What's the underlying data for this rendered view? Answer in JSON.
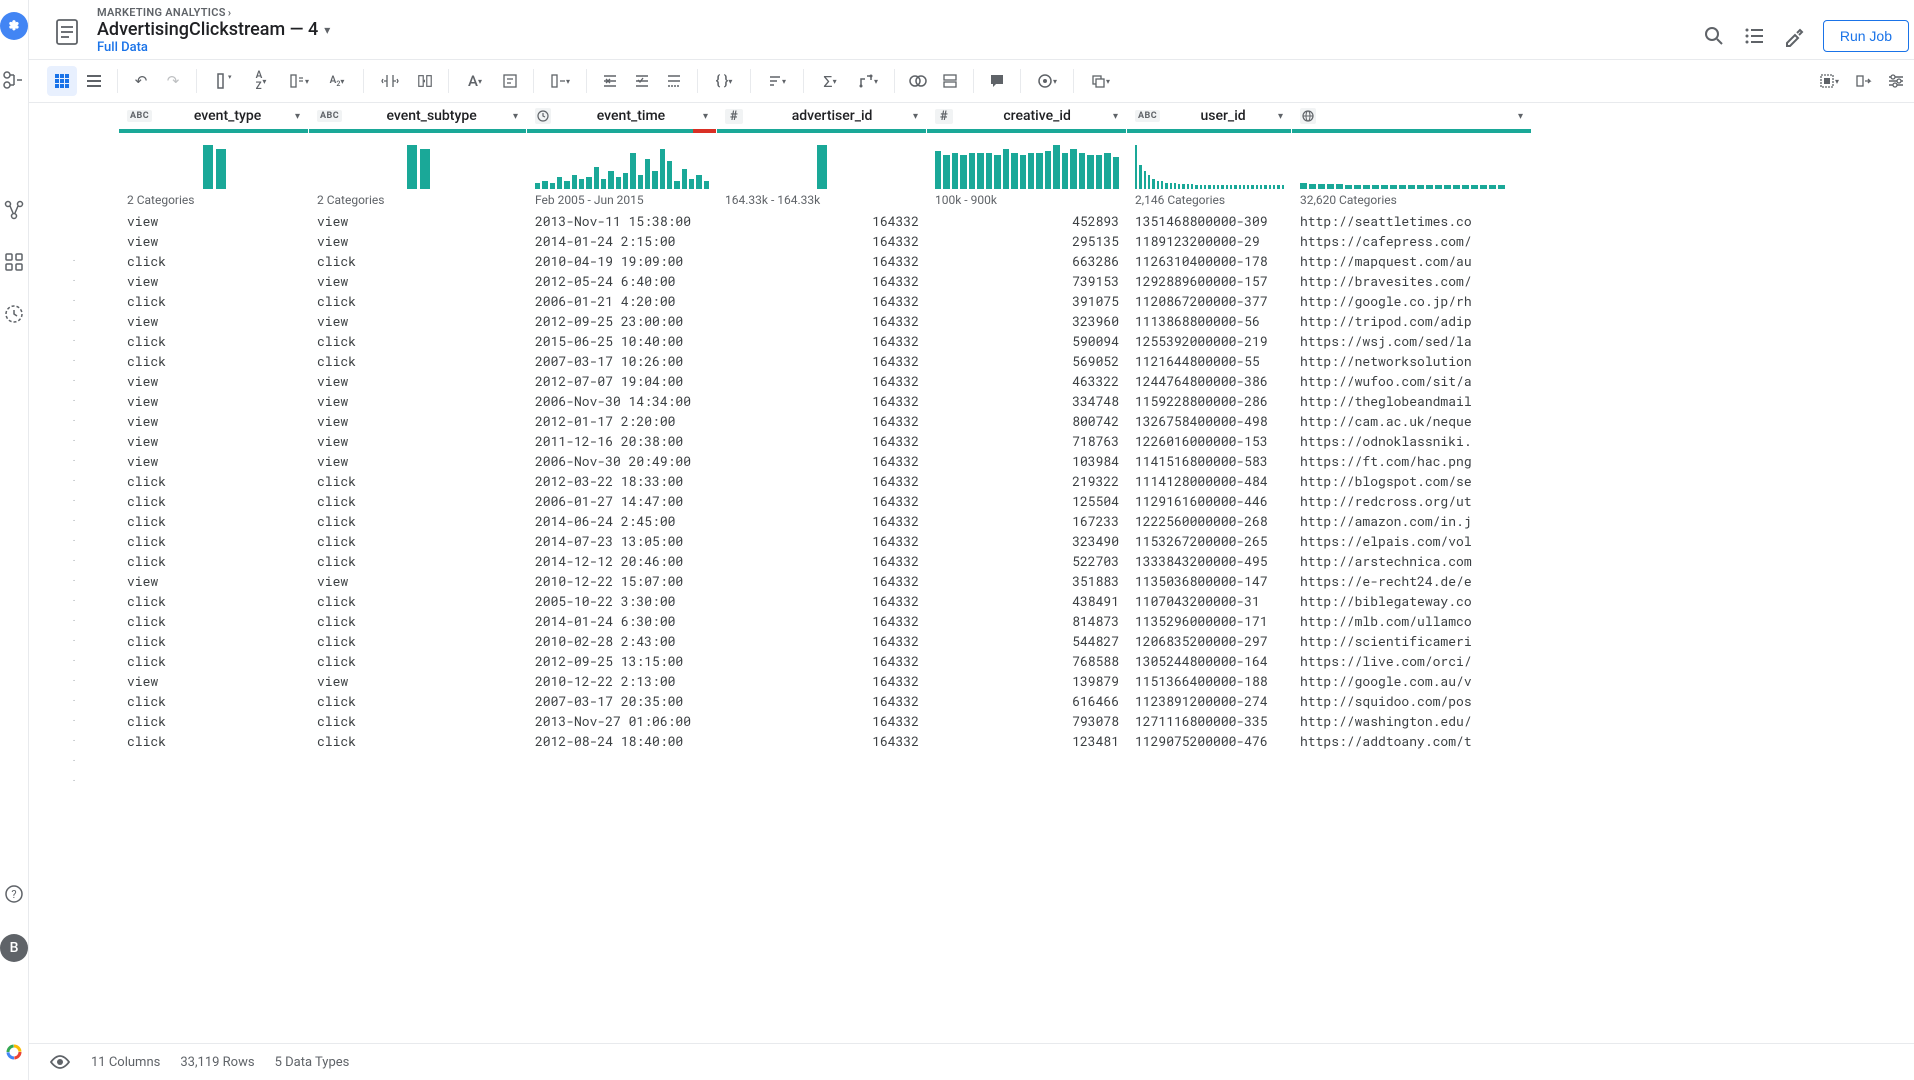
{
  "breadcrumb": {
    "project": "MARKETING ANALYTICS"
  },
  "title": "AdvertisingClickstream — 4",
  "subtitle": "Full Data",
  "run_button_label": "Run Job",
  "avatar_letter": "B",
  "footer": {
    "columns": "11 Columns",
    "rows": "33,119 Rows",
    "types": "5 Data Types"
  },
  "columns": [
    {
      "key": "event_type",
      "label": "event_type",
      "type": "ABC",
      "summary": "2 Categories"
    },
    {
      "key": "event_subtype",
      "label": "event_subtype",
      "type": "ABC",
      "summary": "2 Categories"
    },
    {
      "key": "event_time",
      "label": "event_time",
      "type": "clock",
      "summary": "Feb 2005 - Jun 2015",
      "has_error": true
    },
    {
      "key": "advertiser_id",
      "label": "advertiser_id",
      "type": "#",
      "summary": "164.33k - 164.33k"
    },
    {
      "key": "creative_id",
      "label": "creative_id",
      "type": "#",
      "summary": "100k - 900k"
    },
    {
      "key": "user_id",
      "label": "user_id",
      "type": "ABC",
      "summary": "2,146 Categories"
    },
    {
      "key": "url",
      "label": "",
      "type": "globe",
      "summary": "32,620 Categories"
    }
  ],
  "rows": [
    {
      "event_type": "view",
      "event_subtype": "view",
      "event_time": "2013-Nov-11 15:38:00",
      "advertiser_id": "164332",
      "creative_id": "452893",
      "user_id": "1351468800000-309",
      "url": "http://seattletimes.co"
    },
    {
      "event_type": "view",
      "event_subtype": "view",
      "event_time": "2014-01-24 2:15:00",
      "advertiser_id": "164332",
      "creative_id": "295135",
      "user_id": "1189123200000-29",
      "url": "https://cafepress.com/"
    },
    {
      "event_type": "click",
      "event_subtype": "click",
      "event_time": "2010-04-19 19:09:00",
      "advertiser_id": "164332",
      "creative_id": "663286",
      "user_id": "1126310400000-178",
      "url": "http://mapquest.com/au"
    },
    {
      "event_type": "view",
      "event_subtype": "view",
      "event_time": "2012-05-24 6:40:00",
      "advertiser_id": "164332",
      "creative_id": "739153",
      "user_id": "1292889600000-157",
      "url": "http://bravesites.com/"
    },
    {
      "event_type": "click",
      "event_subtype": "click",
      "event_time": "2006-01-21 4:20:00",
      "advertiser_id": "164332",
      "creative_id": "391075",
      "user_id": "1120867200000-377",
      "url": "http://google.co.jp/rh"
    },
    {
      "event_type": "view",
      "event_subtype": "view",
      "event_time": "2012-09-25 23:00:00",
      "advertiser_id": "164332",
      "creative_id": "323960",
      "user_id": "1113868800000-56",
      "url": "http://tripod.com/adip"
    },
    {
      "event_type": "click",
      "event_subtype": "click",
      "event_time": "2015-06-25 10:40:00",
      "advertiser_id": "164332",
      "creative_id": "590094",
      "user_id": "1255392000000-219",
      "url": "https://wsj.com/sed/la"
    },
    {
      "event_type": "click",
      "event_subtype": "click",
      "event_time": "2007-03-17 10:26:00",
      "advertiser_id": "164332",
      "creative_id": "569052",
      "user_id": "1121644800000-55",
      "url": "http://networksolution"
    },
    {
      "event_type": "view",
      "event_subtype": "view",
      "event_time": "2012-07-07 19:04:00",
      "advertiser_id": "164332",
      "creative_id": "463322",
      "user_id": "1244764800000-386",
      "url": "http://wufoo.com/sit/a"
    },
    {
      "event_type": "view",
      "event_subtype": "view",
      "event_time": "2006-Nov-30 14:34:00",
      "advertiser_id": "164332",
      "creative_id": "334748",
      "user_id": "1159228800000-286",
      "url": "http://theglobeandmail"
    },
    {
      "event_type": "view",
      "event_subtype": "view",
      "event_time": "2012-01-17 2:20:00",
      "advertiser_id": "164332",
      "creative_id": "800742",
      "user_id": "1326758400000-498",
      "url": "http://cam.ac.uk/neque"
    },
    {
      "event_type": "view",
      "event_subtype": "view",
      "event_time": "2011-12-16 20:38:00",
      "advertiser_id": "164332",
      "creative_id": "718763",
      "user_id": "1226016000000-153",
      "url": "https://odnoklassniki."
    },
    {
      "event_type": "view",
      "event_subtype": "view",
      "event_time": "2006-Nov-30 20:49:00",
      "advertiser_id": "164332",
      "creative_id": "103984",
      "user_id": "1141516800000-583",
      "url": "https://ft.com/hac.png"
    },
    {
      "event_type": "click",
      "event_subtype": "click",
      "event_time": "2012-03-22 18:33:00",
      "advertiser_id": "164332",
      "creative_id": "219322",
      "user_id": "1114128000000-484",
      "url": "http://blogspot.com/se"
    },
    {
      "event_type": "click",
      "event_subtype": "click",
      "event_time": "2006-01-27 14:47:00",
      "advertiser_id": "164332",
      "creative_id": "125504",
      "user_id": "1129161600000-446",
      "url": "http://redcross.org/ut"
    },
    {
      "event_type": "click",
      "event_subtype": "click",
      "event_time": "2014-06-24 2:45:00",
      "advertiser_id": "164332",
      "creative_id": "167233",
      "user_id": "1222560000000-268",
      "url": "http://amazon.com/in.j"
    },
    {
      "event_type": "click",
      "event_subtype": "click",
      "event_time": "2014-07-23 13:05:00",
      "advertiser_id": "164332",
      "creative_id": "323490",
      "user_id": "1153267200000-265",
      "url": "https://elpais.com/vol"
    },
    {
      "event_type": "click",
      "event_subtype": "click",
      "event_time": "2014-12-12 20:46:00",
      "advertiser_id": "164332",
      "creative_id": "522703",
      "user_id": "1333843200000-495",
      "url": "http://arstechnica.com"
    },
    {
      "event_type": "view",
      "event_subtype": "view",
      "event_time": "2010-12-22 15:07:00",
      "advertiser_id": "164332",
      "creative_id": "351883",
      "user_id": "1135036800000-147",
      "url": "https://e-recht24.de/e"
    },
    {
      "event_type": "click",
      "event_subtype": "click",
      "event_time": "2005-10-22 3:30:00",
      "advertiser_id": "164332",
      "creative_id": "438491",
      "user_id": "1107043200000-31",
      "url": "http://biblegateway.co"
    },
    {
      "event_type": "click",
      "event_subtype": "click",
      "event_time": "2014-01-24 6:30:00",
      "advertiser_id": "164332",
      "creative_id": "814873",
      "user_id": "1135296000000-171",
      "url": "http://mlb.com/ullamco"
    },
    {
      "event_type": "click",
      "event_subtype": "click",
      "event_time": "2010-02-28 2:43:00",
      "advertiser_id": "164332",
      "creative_id": "544827",
      "user_id": "1206835200000-297",
      "url": "http://scientificameri"
    },
    {
      "event_type": "click",
      "event_subtype": "click",
      "event_time": "2012-09-25 13:15:00",
      "advertiser_id": "164332",
      "creative_id": "768588",
      "user_id": "1305244800000-164",
      "url": "https://live.com/orci/"
    },
    {
      "event_type": "view",
      "event_subtype": "view",
      "event_time": "2010-12-22 2:13:00",
      "advertiser_id": "164332",
      "creative_id": "139879",
      "user_id": "1151366400000-188",
      "url": "http://google.com.au/v"
    },
    {
      "event_type": "click",
      "event_subtype": "click",
      "event_time": "2007-03-17 20:35:00",
      "advertiser_id": "164332",
      "creative_id": "616466",
      "user_id": "1123891200000-274",
      "url": "http://squidoo.com/pos"
    },
    {
      "event_type": "click",
      "event_subtype": "click",
      "event_time": "2013-Nov-27 01:06:00",
      "advertiser_id": "164332",
      "creative_id": "793078",
      "user_id": "1271116800000-335",
      "url": "http://washington.edu/"
    },
    {
      "event_type": "click",
      "event_subtype": "click",
      "event_time": "2012-08-24 18:40:00",
      "advertiser_id": "164332",
      "creative_id": "123481",
      "user_id": "1129075200000-476",
      "url": "https://addtoany.com/t"
    }
  ],
  "hist": {
    "event_type": [
      44,
      40
    ],
    "event_subtype": [
      44,
      40
    ],
    "event_time": [
      6,
      8,
      6,
      12,
      8,
      14,
      10,
      12,
      22,
      10,
      18,
      12,
      16,
      36,
      14,
      30,
      18,
      40,
      28,
      8,
      20,
      10,
      14,
      8
    ],
    "advertiser_id": [
      44
    ],
    "creative_id": [
      38,
      34,
      36,
      34,
      36,
      36,
      36,
      34,
      40,
      36,
      34,
      36,
      36,
      38,
      44,
      36,
      40,
      36,
      34,
      34,
      36,
      32
    ],
    "user_id": [
      44,
      24,
      18,
      14,
      10,
      8,
      8,
      6,
      6,
      6,
      5,
      5,
      5,
      5,
      4,
      4,
      4,
      4,
      4,
      4,
      4,
      4,
      4,
      4,
      4,
      4,
      4,
      4,
      4,
      4,
      4,
      4,
      4,
      4,
      4
    ],
    "url": [
      6,
      5,
      5,
      5,
      5,
      4,
      4,
      4,
      4,
      4,
      4,
      4,
      4,
      4,
      4,
      4,
      4,
      4,
      4,
      4,
      4,
      4,
      4
    ]
  }
}
